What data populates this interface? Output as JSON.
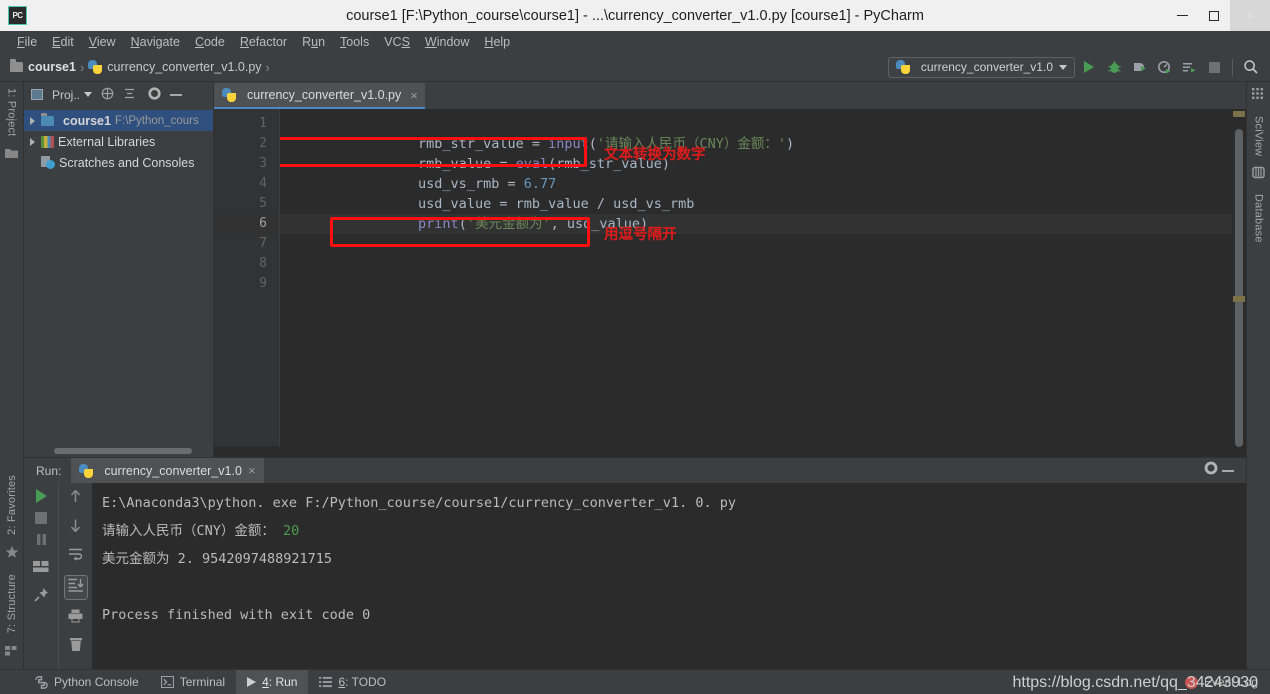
{
  "window": {
    "app_logo": "PC",
    "title": "course1 [F:\\Python_course\\course1] - ...\\currency_converter_v1.0.py [course1] - PyCharm",
    "minimize_label": "–",
    "maximize_label": "□",
    "close_label": "×"
  },
  "menubar": [
    {
      "label": "File"
    },
    {
      "label": "Edit"
    },
    {
      "label": "View"
    },
    {
      "label": "Navigate"
    },
    {
      "label": "Code"
    },
    {
      "label": "Refactor"
    },
    {
      "label": "Run"
    },
    {
      "label": "Tools"
    },
    {
      "label": "VCS"
    },
    {
      "label": "Window"
    },
    {
      "label": "Help"
    }
  ],
  "navbar": {
    "crumbs": [
      "course1",
      "currency_converter_v1.0.py"
    ],
    "separator": "›",
    "run_config": "currency_converter_v1.0",
    "toolbar_icons": [
      "run-icon",
      "debug-icon",
      "coverage-icon",
      "profile-icon",
      "run-with-console-icon",
      "stop-icon",
      "search-icon"
    ]
  },
  "project_panel": {
    "header_label": "Proj..",
    "header_icons": [
      "collapse-all-icon",
      "expand-icon",
      "settings-icon",
      "hide-icon"
    ],
    "tree": [
      {
        "label": "course1",
        "sub": "F:\\Python_cours",
        "icon": "folder-icon",
        "selected": true,
        "expandable": true
      },
      {
        "label": "External Libraries",
        "sub": "",
        "icon": "libraries-icon",
        "selected": false,
        "expandable": true
      },
      {
        "label": "Scratches and Consoles",
        "sub": "",
        "icon": "scratches-icon",
        "selected": false,
        "expandable": false
      }
    ]
  },
  "editor": {
    "tab_label": "currency_converter_v1.0.py",
    "tab_close": "×",
    "line_numbers": [
      "1",
      "2",
      "3",
      "4",
      "5",
      "6",
      "7",
      "8",
      "9"
    ],
    "current_line": 6,
    "lines": [
      {
        "n": 1,
        "segments": [
          {
            "t": "rmb_str_value = ",
            "c": "tok-op"
          },
          {
            "t": "input",
            "c": "tok-fn"
          },
          {
            "t": "(",
            "c": "tok-op"
          },
          {
            "t": "'请输入人民币（CNY）金额：'",
            "c": "tok-str"
          },
          {
            "t": ")",
            "c": "tok-op"
          }
        ]
      },
      {
        "n": 2,
        "segments": [
          {
            "t": "rmb_value = ",
            "c": "tok-op"
          },
          {
            "t": "eval",
            "c": "tok-fn"
          },
          {
            "t": "(rmb_str_value)",
            "c": "tok-op"
          }
        ]
      },
      {
        "n": 3,
        "segments": [
          {
            "t": "usd_vs_rmb = ",
            "c": "tok-op"
          },
          {
            "t": "6.77",
            "c": "tok-num"
          }
        ]
      },
      {
        "n": 4,
        "segments": [
          {
            "t": "usd_value = rmb_value / usd_vs_rmb",
            "c": "tok-op"
          }
        ]
      },
      {
        "n": 5,
        "segments": [
          {
            "t": "print",
            "c": "tok-fn"
          },
          {
            "t": "(",
            "c": "tok-op"
          },
          {
            "t": "'美元金额为'",
            "c": "tok-str"
          },
          {
            "t": ", usd_value)",
            "c": "tok-op"
          }
        ]
      }
    ],
    "annotations": [
      {
        "text": "文本转换为数字",
        "color": "#e01b1b"
      },
      {
        "text": "用逗号隔开",
        "color": "#e01b1b"
      }
    ]
  },
  "run_window": {
    "run_label": "Run:",
    "tab_label": "currency_converter_v1.0",
    "tab_close": "×",
    "left_tools": [
      "rerun-icon",
      "stop-icon",
      "pause-icon",
      "layout-icon",
      "pin-icon"
    ],
    "right_tools": [
      "up-arrow-icon",
      "down-arrow-icon",
      "soft-wrap-icon",
      "scroll-to-end-icon",
      "print-icon",
      "trash-icon"
    ],
    "header_right_icons": [
      "gear-icon",
      "minimize-icon"
    ],
    "console": [
      {
        "text": "E:\\Anaconda3\\python. exe F:/Python_course/course1/currency_converter_v1. 0. py",
        "input": ""
      },
      {
        "text": "请输入人民币（CNY）金额： ",
        "input": "20"
      },
      {
        "text": "美元金额为 2. 9542097488921715",
        "input": ""
      },
      {
        "text": "",
        "input": ""
      },
      {
        "text": "Process finished with exit code 0",
        "input": ""
      }
    ]
  },
  "left_strip": [
    {
      "label": "1: Project",
      "icon": "project-icon"
    },
    {
      "label": "2: Favorites",
      "icon": "star-icon"
    },
    {
      "label": "7: Structure",
      "icon": "structure-icon"
    }
  ],
  "right_strip": [
    {
      "label": "SciView",
      "icon": "sciview-icon"
    },
    {
      "label": "Database",
      "icon": "database-icon"
    }
  ],
  "statusbar": {
    "items": [
      {
        "label": "Python Console",
        "icon": "python-console-icon",
        "active": false
      },
      {
        "label": "Terminal",
        "icon": "terminal-icon",
        "active": false
      },
      {
        "label": "4: Run",
        "icon": "run-icon",
        "active": true
      },
      {
        "label": "6: TODO",
        "icon": "todo-icon",
        "active": false
      }
    ],
    "event_log": "Event Log",
    "watermark": "https://blog.csdn.net/qq_34243930"
  },
  "colors": {
    "accent_blue": "#4a88c7",
    "run_green": "#499c54",
    "annotation_red": "#ff1010",
    "string_green": "#6a8759",
    "number_blue": "#6897bb",
    "function_purple": "#8888c6"
  }
}
